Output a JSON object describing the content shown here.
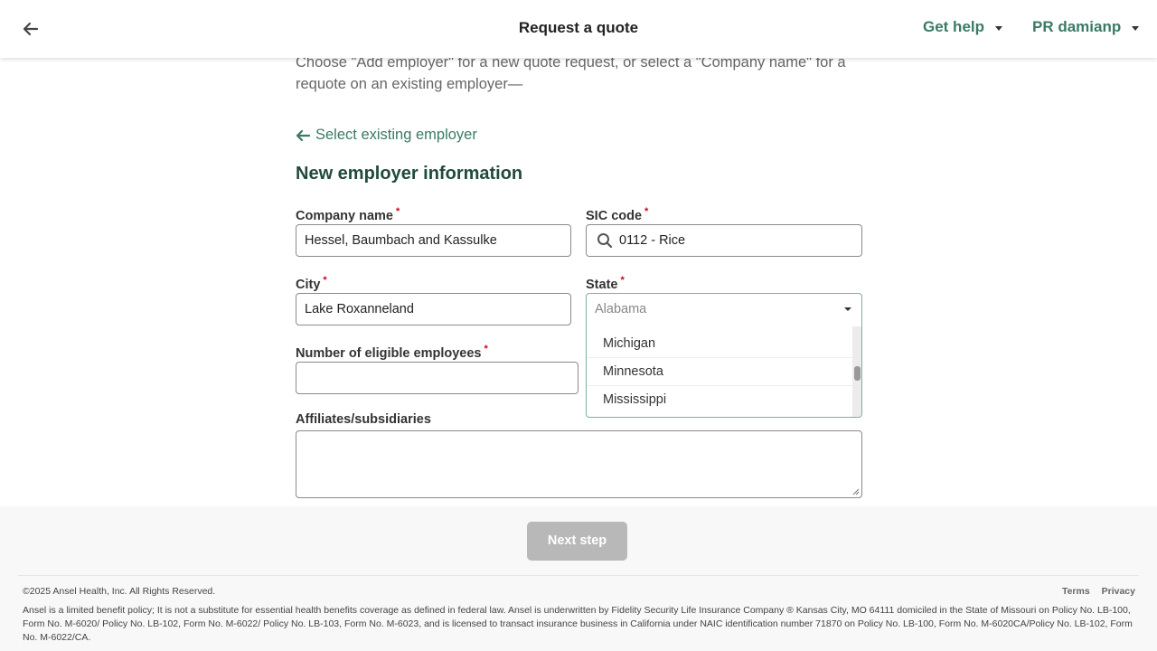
{
  "header": {
    "title": "Request a quote",
    "help_label": "Get help",
    "user_label": "PR damianp"
  },
  "main": {
    "intro": "Choose \"Add employer\" for a new quote request, or select a \"Company name\" for a requote on an existing employer—",
    "select_existing_label": "Select existing employer",
    "section_title": "New employer information",
    "company_name": {
      "label": "Company name",
      "value": "Hessel, Baumbach and Kassulke"
    },
    "sic_code": {
      "label": "SIC code",
      "value": "0112 - Rice"
    },
    "city": {
      "label": "City",
      "value": "Lake Roxanneland"
    },
    "state": {
      "label": "State",
      "value": "Alabama",
      "visible_options": [
        "Michigan",
        "Minnesota",
        "Mississippi"
      ]
    },
    "employees": {
      "label": "Number of eligible employees",
      "value": ""
    },
    "affiliates": {
      "label": "Affiliates/subsidiaries",
      "value": ""
    },
    "required_marker": "*"
  },
  "footer": {
    "next_label": "Next step",
    "copyright": "©2025 Ansel Health, Inc. All Rights Reserved.",
    "terms_label": "Terms",
    "privacy_label": "Privacy",
    "disclaimer": "Ansel is a limited benefit policy; It is not a substitute for essential health benefits coverage as defined in federal law. Ansel is underwritten by Fidelity Security Life Insurance Company ® Kansas City, MO 64111 domiciled in the State of Missouri on Policy No. LB-100, Form No. M-6020/ Policy No. LB-102, Form No. M-6022/ Policy No. LB-103, Form No. M-6023, and is licensed to transact insurance business in California under NAIC identification number 71870 on Policy No. LB-100, Form No. M-6020CA/Policy No. LB-102, Form No. M-6022/CA."
  },
  "colors": {
    "accent": "#3b7a66",
    "heading": "#1f4a3c",
    "required": "#d0021b",
    "disabled_button": "#b8b8b8"
  },
  "icons": {
    "back": "arrow-left-icon",
    "select_existing": "arrow-left-icon",
    "search": "search-icon",
    "dropdown": "caret-down-icon"
  }
}
